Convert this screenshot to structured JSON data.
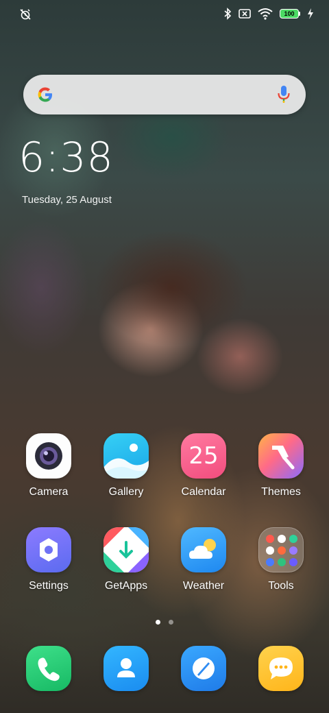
{
  "status_bar": {
    "battery_level": "100",
    "icons": [
      "alarm-off-icon",
      "bluetooth-icon",
      "sim-off-icon",
      "wifi-icon",
      "battery-icon",
      "charging-icon"
    ]
  },
  "search": {
    "icons": [
      "google-logo-icon",
      "microphone-icon"
    ]
  },
  "clock": {
    "time": "6:38",
    "date": "Tuesday, 25 August"
  },
  "apps": {
    "camera": "Camera",
    "gallery": "Gallery",
    "calendar": "Calendar",
    "calendar_day": "25",
    "themes": "Themes",
    "settings": "Settings",
    "getapps": "GetApps",
    "weather": "Weather",
    "tools": "Tools"
  },
  "dock": {
    "icons": [
      "phone-icon",
      "contacts-icon",
      "browser-icon",
      "messages-icon"
    ]
  },
  "page_indicator": {
    "pages": 2,
    "current": 1
  },
  "colors": {
    "accent_green": "#4cd964",
    "google_blue": "#4285f4",
    "google_red": "#ea4335",
    "google_yellow": "#fbbc05",
    "google_green": "#34a853"
  }
}
